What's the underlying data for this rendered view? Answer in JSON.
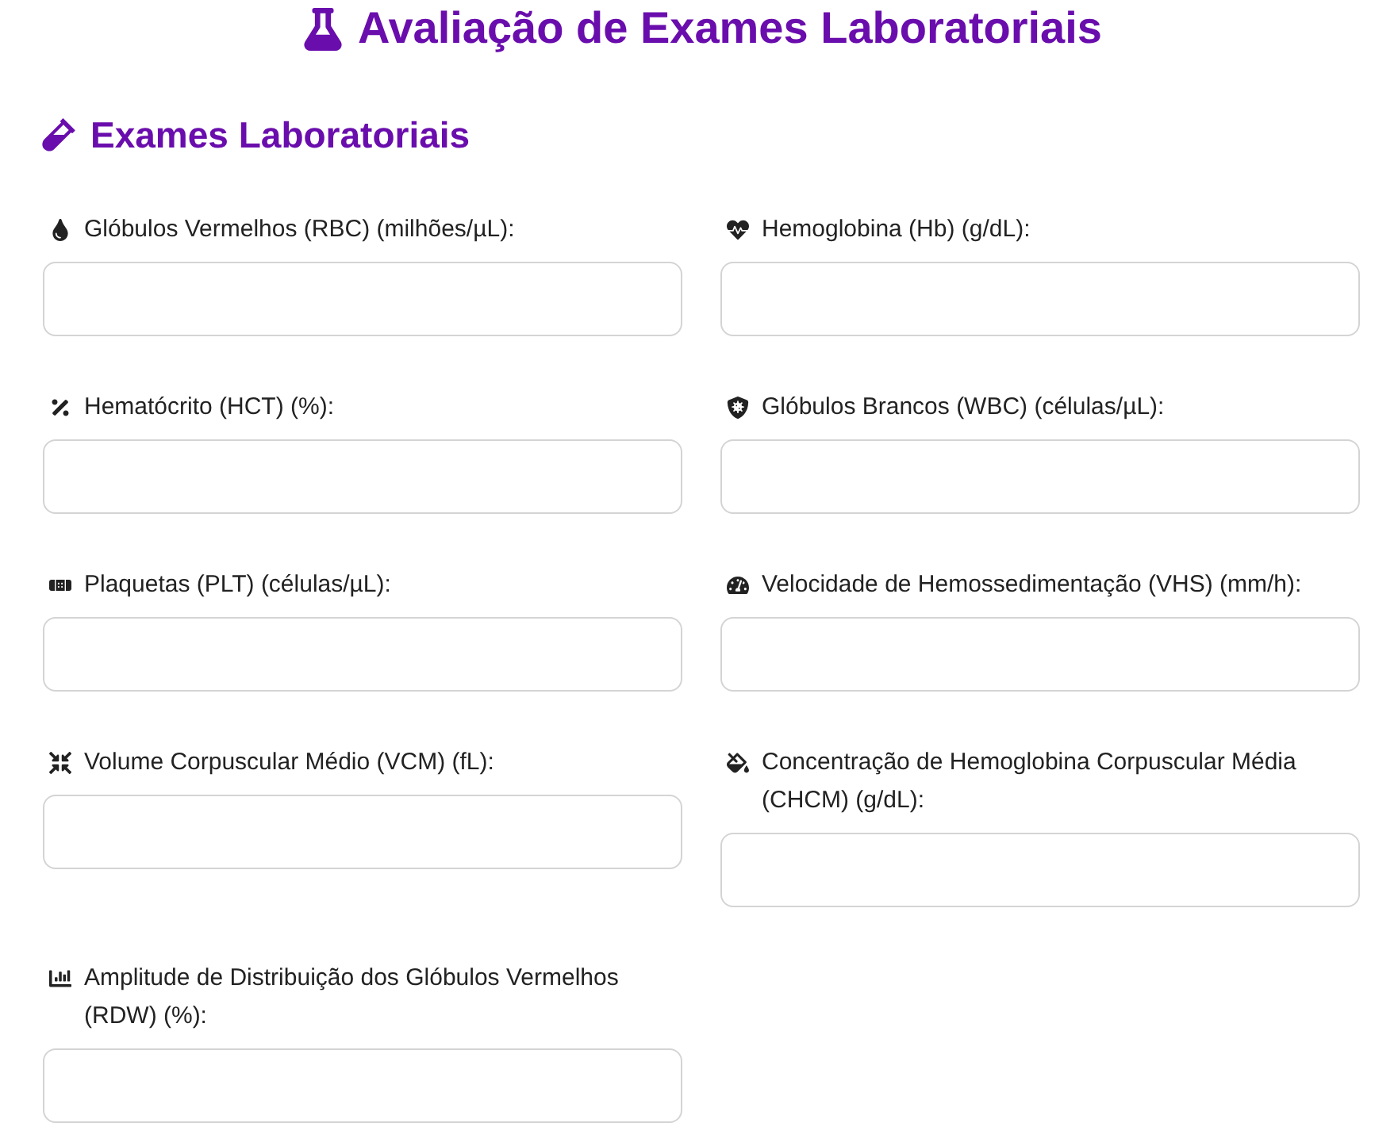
{
  "header": {
    "title": "Avaliação de Exames Laboratoriais"
  },
  "section": {
    "title": "Exames Laboratoriais",
    "fields": [
      {
        "label": "Glóbulos Vermelhos (RBC) (milhões/µL):"
      },
      {
        "label": "Hemoglobina (Hb) (g/dL):"
      },
      {
        "label": "Hematócrito (HCT) (%):"
      },
      {
        "label": "Glóbulos Brancos (WBC) (células/µL):"
      },
      {
        "label": "Plaquetas (PLT) (células/µL):"
      },
      {
        "label": "Velocidade de Hemossedimentação (VHS) (mm/h):"
      },
      {
        "label": "Volume Corpuscular Médio (VCM) (fL):"
      },
      {
        "label": "Concentração de Hemoglobina Corpuscular Média (CHCM) (g/dL):"
      },
      {
        "label": "Amplitude de Distribuição dos Glóbulos Vermelhos (RDW) (%):"
      }
    ]
  }
}
